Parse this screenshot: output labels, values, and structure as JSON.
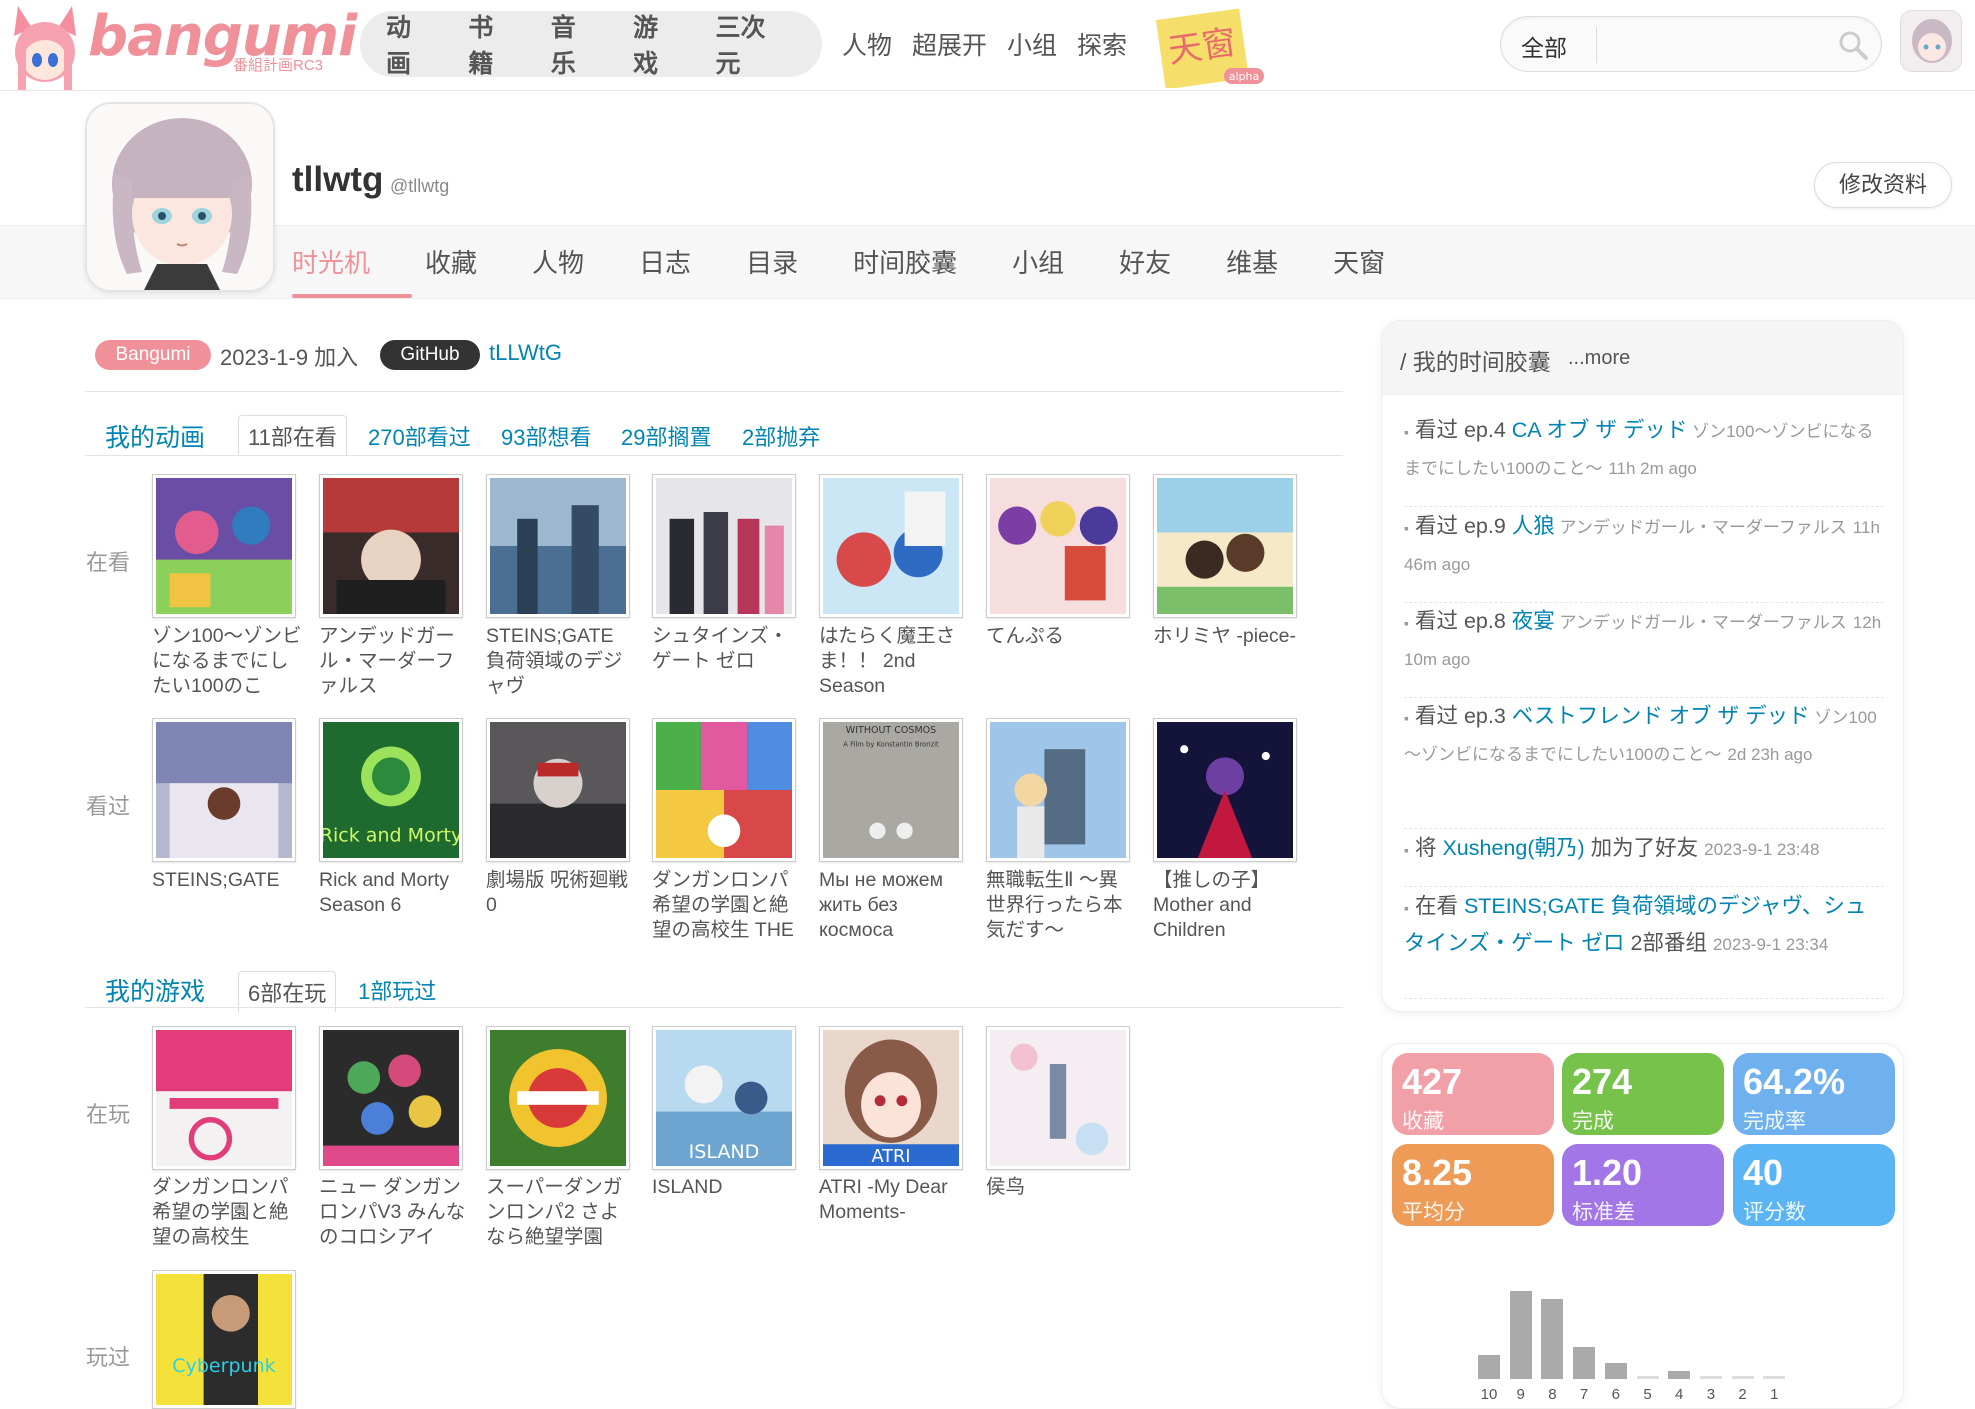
{
  "header": {
    "logo_text": "bangumi",
    "logo_sub": "番組計画RC3",
    "nav_main": [
      "动画",
      "书籍",
      "音乐",
      "游戏",
      "三次元"
    ],
    "nav_secondary": [
      "人物",
      "超展开",
      "小组",
      "探索"
    ],
    "tianchuang_logo": "天窗",
    "tianchuang_sub": "alpha",
    "search_scope": "全部",
    "search_value": ""
  },
  "profile": {
    "name": "tllwtg",
    "handle": "@tllwtg",
    "edit_label": "修改资料",
    "tabs": [
      "时光机",
      "收藏",
      "人物",
      "日志",
      "目录",
      "时间胶囊",
      "小组",
      "好友",
      "维基",
      "天窗"
    ],
    "active_tab": "时光机",
    "badge_bangumi": "Bangumi",
    "join_text": "2023-1-9 加入",
    "badge_github": "GitHub",
    "github_user": "tLLWtG"
  },
  "anime": {
    "title": "我的动画",
    "stats": [
      "11部在看",
      "270部看过",
      "93部想看",
      "29部搁置",
      "2部抛弃"
    ],
    "watching_label": "在看",
    "watched_label": "看过",
    "watching": [
      "ゾン100～ゾンビになるまでにしたい100のこ",
      "アンデッドガール・マーダーファルス",
      "STEINS;GATE 負荷領域のデジャヴ",
      "シュタインズ・ゲート ゼロ",
      "はたらく魔王さま！！ 2nd Season",
      "てんぷる",
      "ホリミヤ -piece-"
    ],
    "watched": [
      "STEINS;GATE",
      "Rick and Morty Season 6",
      "劇場版 呪術廻戦 0",
      "ダンガンロンパ 希望の学園と絶望の高校生 THE",
      "Мы не можем жить без космоса",
      "無職転生Ⅱ ～異世界行ったら本気だす～",
      "【推しの子】 Mother and Children"
    ],
    "watched_cover_text": {
      "rick": "Rick and Morty",
      "cosmos_top": "WITHOUT COSMOS",
      "cosmos_film": "A Film by Konstantin Bronzit"
    }
  },
  "games": {
    "title": "我的游戏",
    "stats": [
      "6部在玩",
      "1部玩过"
    ],
    "playing_label": "在玩",
    "played_label": "玩过",
    "playing": [
      "ダンガンロンパ 希望の学園と絶望の高校生",
      "ニュー ダンガンロンパV3 みんなのコロシアイ",
      "スーパーダンガンロンパ2 さよなら絶望学園",
      "ISLAND",
      "ATRI -My Dear Moments-",
      "侯鸟"
    ],
    "played": [
      ""
    ],
    "cover_text": {
      "island": "ISLAND",
      "atri": "ATRI",
      "cyberpunk": "Cyberpunk"
    }
  },
  "timeline": {
    "title": "/ 我的时间胶囊",
    "more": "...more",
    "items": [
      {
        "prefix": "看过 ep.4 ",
        "link": "CA オブ ザ デッド",
        "rest": " ゾン100～ゾンビになるまでにしたい100のこと～",
        "time": "11h 2m ago"
      },
      {
        "prefix": "看过 ep.9 ",
        "link": "人狼",
        "rest": " アンデッドガール・マーダーファルス",
        "time": "11h 46m ago"
      },
      {
        "prefix": "看过 ep.8 ",
        "link": "夜宴",
        "rest": " アンデッドガール・マーダーファルス",
        "time": "12h 10m ago"
      },
      {
        "prefix": "看过 ep.3 ",
        "link": "ベストフレンド オブ ザ デッド",
        "rest": " ゾン100～ゾンビになるまでにしたい100のこと～",
        "time": "2d 23h ago"
      },
      {
        "prefix": "将 ",
        "link": "Xusheng(朝乃)",
        "rest": " 加为了好友",
        "time": "2023-9-1 23:48"
      },
      {
        "prefix": "在看 ",
        "link": "STEINS;GATE 負荷領域のデジャヴ、シュタインズ・ゲート ゼロ",
        "rest": " 2部番组",
        "time": "2023-9-1 23:34"
      }
    ]
  },
  "stats": {
    "boxes": [
      {
        "num": "427",
        "label": "收藏",
        "color": "#f2a0a8"
      },
      {
        "num": "274",
        "label": "完成",
        "color": "#77c24a"
      },
      {
        "num": "64.2%",
        "label": "完成率",
        "color": "#6fb0ee"
      },
      {
        "num": "8.25",
        "label": "平均分",
        "color": "#ef9b58"
      },
      {
        "num": "1.20",
        "label": "标准差",
        "color": "#a276e6"
      },
      {
        "num": "40",
        "label": "评分数",
        "color": "#5bb5f5"
      }
    ]
  },
  "chart_data": {
    "type": "bar",
    "categories": [
      "10",
      "9",
      "8",
      "7",
      "6",
      "5",
      "4",
      "3",
      "2",
      "1"
    ],
    "values": [
      3,
      11,
      10,
      4,
      2,
      0,
      1,
      0,
      0,
      0
    ],
    "title": "",
    "xlabel": "",
    "ylabel": "",
    "ylim": [
      0,
      11
    ]
  }
}
